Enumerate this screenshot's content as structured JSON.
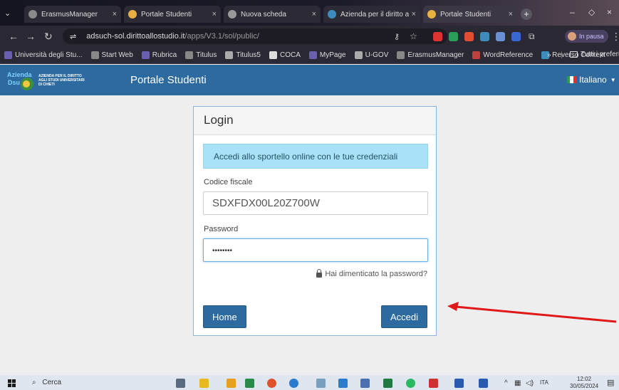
{
  "browser": {
    "tabs": [
      {
        "title": "ErasmusManager",
        "favicon_color": "#8a8a8a",
        "active": false
      },
      {
        "title": "Portale Studenti",
        "favicon_color": "#e8b040",
        "active": false
      },
      {
        "title": "Nuova scheda",
        "favicon_color": "#999999",
        "active": false
      },
      {
        "title": "Azienda per il diritto agl",
        "favicon_color": "#3c8dbc",
        "active": false
      },
      {
        "title": "Portale Studenti",
        "favicon_color": "#e8b040",
        "active": true
      }
    ],
    "url_site": "adsuch-sol.dirittoallostudio.it",
    "url_path": "/apps/V3.1/sol/public/",
    "profile_label": "In pausa",
    "bookmarks": [
      {
        "label": "Università degli Stu...",
        "color": "#6b5fb0"
      },
      {
        "label": "Start Web",
        "color": "#888888"
      },
      {
        "label": "Rubrica",
        "color": "#6b5fb0"
      },
      {
        "label": "Titulus",
        "color": "#888888"
      },
      {
        "label": "Titulus5",
        "color": "#aaaaaa"
      },
      {
        "label": "COCA",
        "color": "#dddddd"
      },
      {
        "label": "MyPage",
        "color": "#6b5fb0"
      },
      {
        "label": "U-GOV",
        "color": "#aaaaaa"
      },
      {
        "label": "ErasmusManager",
        "color": "#888888"
      },
      {
        "label": "WordReference",
        "color": "#c04040"
      },
      {
        "label": "Reverso Context",
        "color": "#3c8dbc"
      }
    ],
    "bookmarks_more": "»",
    "all_bookmarks": "Tutti i preferiti"
  },
  "site": {
    "logo_text_1": "AZIENDA PER IL DIRITTO",
    "logo_text_2": "AGLI STUDI UNIVERSITARI",
    "logo_text_3": "DI CHIETI",
    "logo_mark_1": "Azienda",
    "logo_mark_2": "Dsu",
    "title": "Portale Studenti",
    "language": "Italiano",
    "header_color": "#2c6aa0"
  },
  "login": {
    "heading": "Login",
    "info": "Accedi allo sportello online con le tue credenziali",
    "codice_label": "Codice fiscale",
    "codice_value": "SDXFDX00L20Z700W",
    "password_label": "Password",
    "password_value": "••••••••",
    "forgot": "Hai dimenticato la password?",
    "home_button": "Home",
    "submit_button": "Accedi"
  },
  "taskbar": {
    "search_placeholder": "Cerca",
    "language": "ITA",
    "time": "12:02",
    "date": "30/05/2024"
  }
}
